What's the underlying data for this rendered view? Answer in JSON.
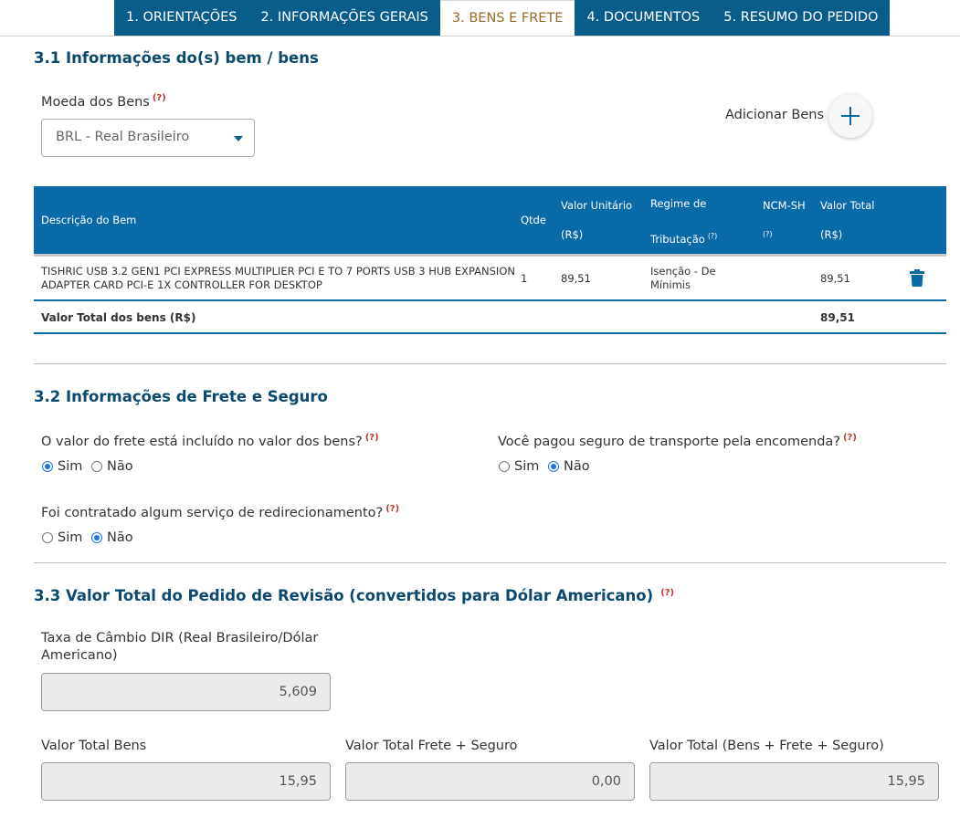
{
  "tabs": [
    {
      "label": "1. ORIENTAÇÕES"
    },
    {
      "label": "2. INFORMAÇÕES GERAIS"
    },
    {
      "label": "3. BENS E FRETE"
    },
    {
      "label": "4. DOCUMENTOS"
    },
    {
      "label": "5. RESUMO DO PEDIDO"
    }
  ],
  "help_marker": "(?)",
  "section1": {
    "title": "3.1 Informações do(s) bem / bens",
    "currency_label": "Moeda dos Bens",
    "currency_value": "BRL - Real Brasileiro",
    "add_label": "Adicionar Bens"
  },
  "table": {
    "headers": {
      "description": "Descrição do Bem",
      "qty": "Qtde",
      "unit_value_1": "Valor Unitário",
      "unit_value_2": "(R$)",
      "regime_1": "Regime de",
      "regime_2": "Tributação",
      "ncm_1": "NCM-SH",
      "total_1": "Valor Total",
      "total_2": "(R$)"
    },
    "rows": [
      {
        "description_1": "TISHRIC USB 3.2 GEN1 PCI EXPRESS MULTIPLIER PCI E TO 7 PORTS USB 3 HUB EXPANSION",
        "description_2": "ADAPTER CARD PCI-E 1X CONTROLLER FOR DESKTOP",
        "qty": "1",
        "unit_value": "89,51",
        "regime_1": "Isenção - De",
        "regime_2": "Mínimis",
        "total": "89,51"
      }
    ],
    "footer_label": "Valor Total dos bens (R$)",
    "footer_total": "89,51"
  },
  "section2": {
    "title": "3.2 Informações de Frete e Seguro",
    "q1": "O valor do frete está incluído no valor dos bens?",
    "q2": "Você pagou seguro de transporte pela encomenda?",
    "q3": "Foi contratado algum serviço de redirecionamento?",
    "yes": "Sim",
    "no": "Não"
  },
  "section3": {
    "title": "3.3 Valor Total do Pedido de Revisão (convertidos para Dólar Americano)",
    "rate_label_1": "Taxa de Câmbio DIR (Real Brasileiro/Dólar",
    "rate_label_2": "Americano)",
    "rate_value": "5,609",
    "goods_label": "Valor Total Bens",
    "goods_value": "15,95",
    "freight_label": "Valor Total Frete + Seguro",
    "freight_value": "0,00",
    "total_label": "Valor Total (Bens + Frete + Seguro)",
    "total_value": "15,95"
  },
  "colors": {
    "tab_bg": "#0a5c8a",
    "table_header_bg": "#0a6aa8",
    "section_title": "#0b4a6e",
    "help_marker": "#c0392b"
  }
}
